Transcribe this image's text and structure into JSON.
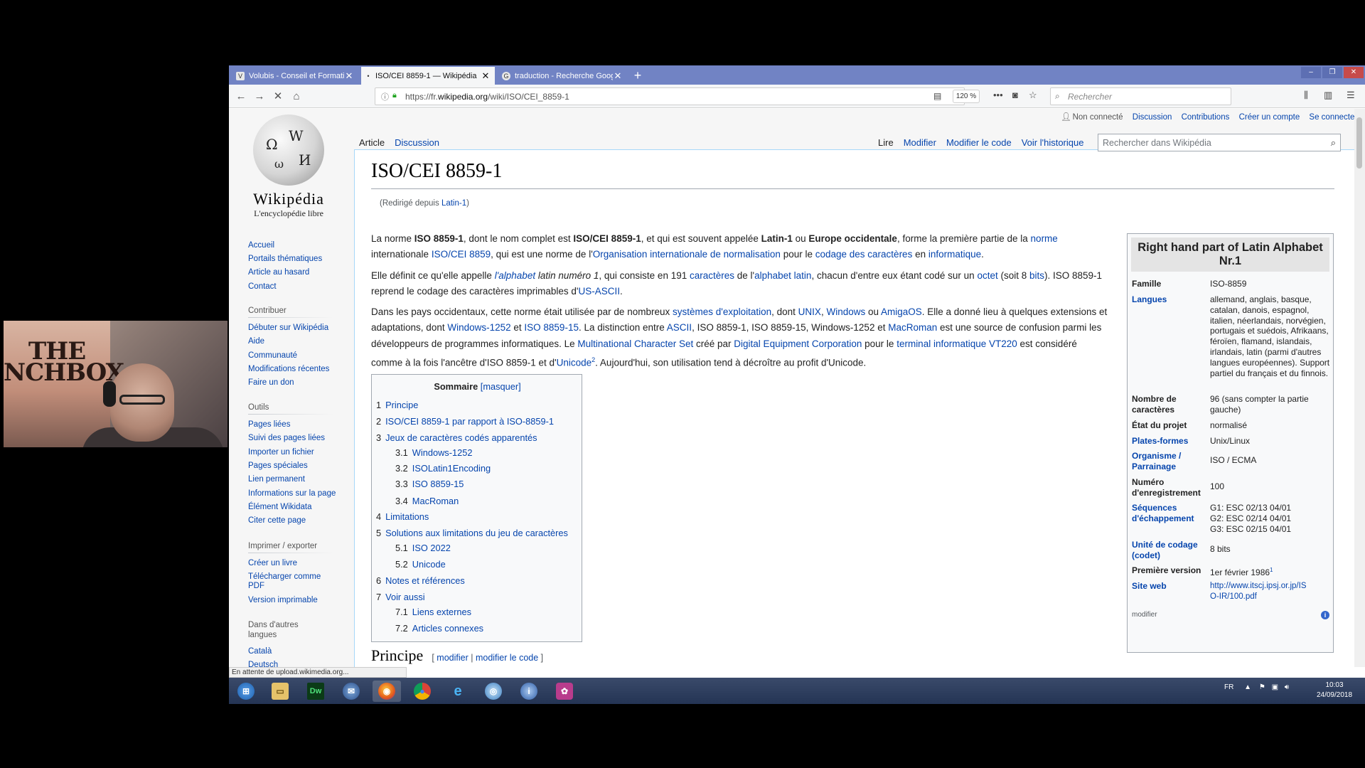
{
  "browser": {
    "tabs": [
      {
        "label": "Volubis - Conseil et Formation",
        "favicon": "V"
      },
      {
        "label": "ISO/CEI 8859-1 — Wikipédia",
        "favicon": "W"
      },
      {
        "label": "traduction - Recherche Google",
        "favicon": "G"
      }
    ],
    "url_prefix": "https://fr.",
    "url_domain": "wikipedia.org",
    "url_path": "/wiki/ISO/CEI_8859-1",
    "zoom": "120 %",
    "search_placeholder": "Rechercher",
    "status": "En attente de upload.wikimedia.org..."
  },
  "wiki": {
    "logo_word": "Wikipédia",
    "logo_tagline": "L'encyclopédie libre",
    "user_links": {
      "not_logged": "Non connecté",
      "discussion": "Discussion",
      "contributions": "Contributions",
      "create": "Créer un compte",
      "login": "Se connecter"
    },
    "tabs_left": [
      "Article",
      "Discussion"
    ],
    "tabs_right": [
      "Lire",
      "Modifier",
      "Modifier le code",
      "Voir l'historique"
    ],
    "search_placeholder": "Rechercher dans Wikipédia",
    "sidebar": {
      "nav": [
        "Accueil",
        "Portails thématiques",
        "Article au hasard",
        "Contact"
      ],
      "contribuer_head": "Contribuer",
      "contribuer": [
        "Débuter sur Wikipédia",
        "Aide",
        "Communauté",
        "Modifications récentes",
        "Faire un don"
      ],
      "outils_head": "Outils",
      "outils": [
        "Pages liées",
        "Suivi des pages liées",
        "Importer un fichier",
        "Pages spéciales",
        "Lien permanent",
        "Informations sur la page",
        "Élément Wikidata",
        "Citer cette page"
      ],
      "imprimer_head": "Imprimer / exporter",
      "imprimer": [
        "Créer un livre",
        "Télécharger comme PDF",
        "Version imprimable"
      ],
      "langues_head": "Dans d'autres langues",
      "langues": [
        "Català",
        "Deutsch"
      ]
    },
    "title": "ISO/CEI 8859-1",
    "redirect_prefix": "(Redirigé depuis ",
    "redirect_link": "Latin-1",
    "redirect_suffix": ")",
    "toc": {
      "title": "Sommaire",
      "toggle": "[masquer]",
      "items": [
        {
          "num": "1",
          "label": "Principe"
        },
        {
          "num": "2",
          "label": "ISO/CEI 8859-1 par rapport à ISO-8859-1"
        },
        {
          "num": "3",
          "label": "Jeux de caractères codés apparentés"
        },
        {
          "num": "3.1",
          "label": "Windows-1252"
        },
        {
          "num": "3.2",
          "label": "ISOLatin1Encoding"
        },
        {
          "num": "3.3",
          "label": "ISO 8859-15"
        },
        {
          "num": "3.4",
          "label": "MacRoman"
        },
        {
          "num": "4",
          "label": "Limitations"
        },
        {
          "num": "5",
          "label": "Solutions aux limitations du jeu de caractères"
        },
        {
          "num": "5.1",
          "label": "ISO 2022"
        },
        {
          "num": "5.2",
          "label": "Unicode"
        },
        {
          "num": "6",
          "label": "Notes et références"
        },
        {
          "num": "7",
          "label": "Voir aussi"
        },
        {
          "num": "7.1",
          "label": "Liens externes"
        },
        {
          "num": "7.2",
          "label": "Articles connexes"
        }
      ]
    },
    "section2_title": "Principe",
    "section2_edit_open": "[ ",
    "section2_edit1": "modifier",
    "section2_edit_sep": " | ",
    "section2_edit2": "modifier le code",
    "section2_edit_close": " ]",
    "infobox": {
      "title": "Right hand part of Latin Alphabet Nr.1",
      "rows": [
        {
          "label": "Famille",
          "value": "ISO-8859"
        },
        {
          "label": "Langues",
          "value": "allemand, anglais, basque, catalan, danois, espagnol, italien, néerlandais, norvégien, portugais et suédois, Afrikaans, féroïen, flamand, islandais, irlandais, latin (parmi d'autres langues européennes). Support partiel du français et du finnois."
        },
        {
          "label": "Nombre de caractères",
          "value": "96 (sans compter la partie gauche)"
        },
        {
          "label": "État du projet",
          "value": "normalisé"
        },
        {
          "label": "Plates-formes",
          "value": "Unix/Linux"
        },
        {
          "label": "Organisme / Parrainage",
          "value": "ISO / ECMA"
        },
        {
          "label": "Numéro d'enregistrement",
          "value": "100"
        },
        {
          "label": "Séquences d'échappement",
          "value": "G1: ESC 02/13 04/01 G2: ESC 02/14 04/01 G3: ESC 02/15 04/01"
        },
        {
          "label": "Unité de codage (codet)",
          "value": "8 bits"
        },
        {
          "label": "Première version",
          "value": "1er février 1986"
        },
        {
          "label": "Site web",
          "value": "http://www.itscj.ipsj.or.jp/ISO-IR/100.pdf"
        }
      ],
      "first_version_sup": "1",
      "modifier": "modifier"
    }
  },
  "taskbar": {
    "lang": "FR",
    "time": "10:03",
    "date": "24/09/2018"
  }
}
